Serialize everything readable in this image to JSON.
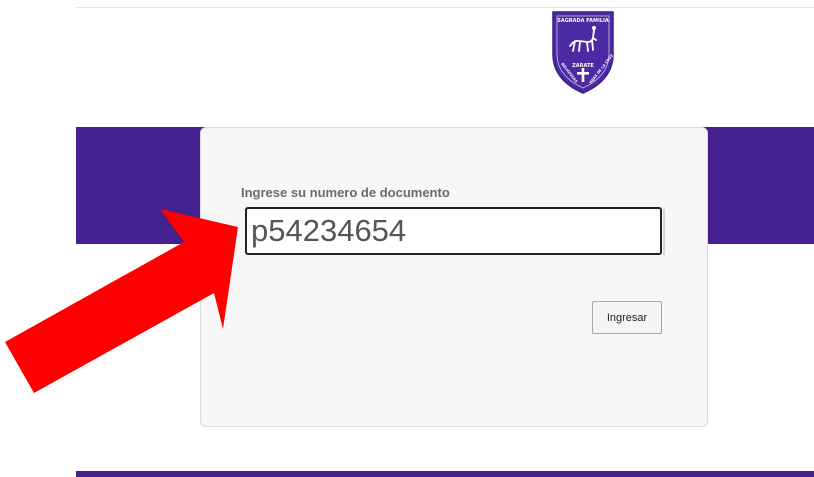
{
  "logo": {
    "icon": "school-crest-icon",
    "lettering": "COLEGIO SAGRADA FAMILIA · ZARATE · RELIGIOSAS HIJAS DE LA CRUZ"
  },
  "login": {
    "label": "Ingrese su numero de documento",
    "document_value": "p54234654",
    "submit_label": "Ingresar"
  },
  "annotation": {
    "icon": "arrow-icon"
  },
  "colors": {
    "brand_purple": "#45208f",
    "crest_purple": "#4b2aa3",
    "arrow_red": "#ff0000"
  }
}
